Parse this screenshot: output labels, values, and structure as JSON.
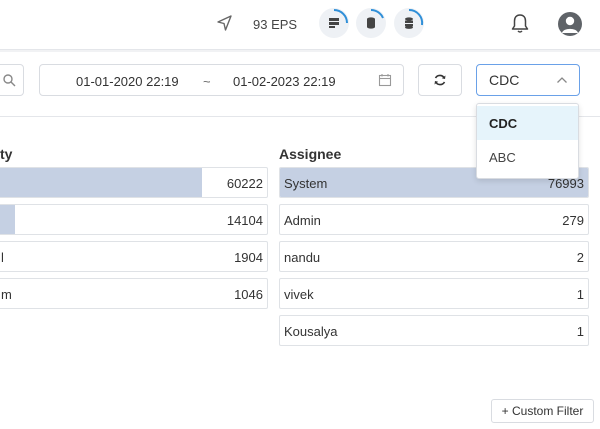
{
  "header": {
    "eps_text": "93 EPS",
    "icons": [
      "navigation-icon",
      "server-ring-icon",
      "database-ring-icon",
      "storage-ring-icon",
      "bell-icon",
      "user-avatar-icon"
    ]
  },
  "filters": {
    "date_from": "01-01-2020 22:19",
    "date_separator": "~",
    "date_to": "01-02-2023 22:19",
    "select_value": "CDC",
    "custom_filter_label": "+ Custom Filter"
  },
  "dropdown": {
    "options": [
      {
        "label": "CDC",
        "selected": true
      },
      {
        "label": "ABC",
        "selected": false
      }
    ]
  },
  "left_panel": {
    "title": "ty",
    "rows": [
      {
        "label": "",
        "value": "60222",
        "fill_fraction": 0.78
      },
      {
        "label": "",
        "value": "14104",
        "fill_fraction": 0.15
      },
      {
        "label": "l",
        "value": "1904",
        "fill_fraction": 0
      },
      {
        "label": "m",
        "value": "1046",
        "fill_fraction": 0
      }
    ]
  },
  "right_panel": {
    "title": "Assignee",
    "rows": [
      {
        "label": "System",
        "value": "76993",
        "fill_fraction": 1.0
      },
      {
        "label": "Admin",
        "value": "279",
        "fill_fraction": 0
      },
      {
        "label": "nandu",
        "value": "2",
        "fill_fraction": 0
      },
      {
        "label": "vivek",
        "value": "1",
        "fill_fraction": 0
      },
      {
        "label": "Kousalya",
        "value": "1",
        "fill_fraction": 0
      }
    ]
  },
  "colors": {
    "accent": "#2f8fd8",
    "bar_fill": "#c5d0e3",
    "select_border": "#6aa1e8",
    "selected_option_bg": "#e6f4fb"
  }
}
